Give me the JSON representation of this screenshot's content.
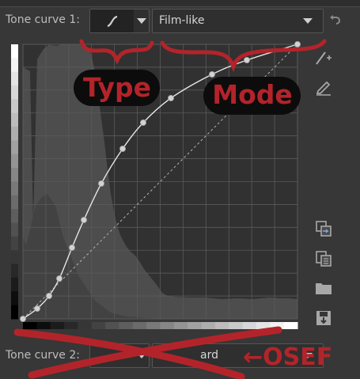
{
  "top_control": {
    "label": "Tone curve 1:",
    "mode_value": "Film-like"
  },
  "bottom_control": {
    "label": "Tone curve 2:",
    "mode_value": "ard"
  },
  "annotations": {
    "type_label": "Type",
    "mode_label": "Mode",
    "osef_label": "←OSEF"
  },
  "colors": {
    "annotation_red": "#b3242a",
    "panel_bg": "#373737",
    "graph_bg": "#313131"
  },
  "icons": [
    "curve-type-icon",
    "chevron-down-icon",
    "reset-arrow-icon",
    "add-point-icon",
    "edit-point-icon",
    "copy-icon",
    "paste-icon",
    "open-folder-icon",
    "save-icon"
  ]
}
